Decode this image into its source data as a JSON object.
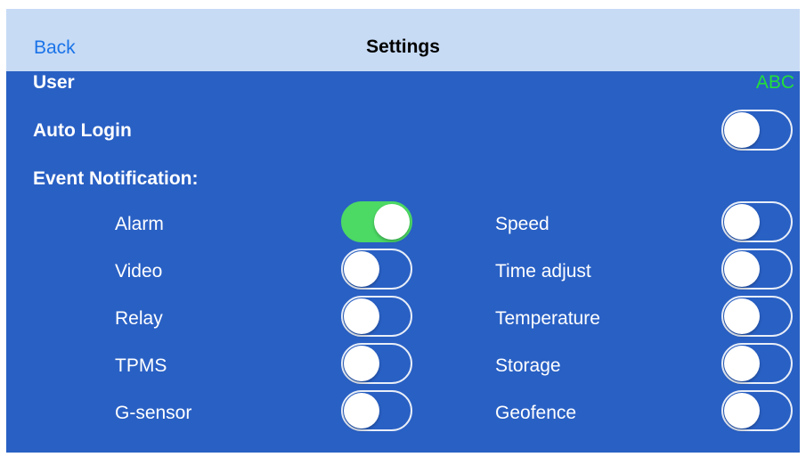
{
  "nav": {
    "back_label": "Back",
    "title": "Settings"
  },
  "user": {
    "label": "User",
    "value": "ABC",
    "value_color": "#22e03a"
  },
  "auto_login": {
    "label": "Auto Login",
    "on": false
  },
  "events": {
    "heading": "Event Notification:",
    "left": [
      {
        "label": "Alarm",
        "on": true
      },
      {
        "label": "Video",
        "on": false
      },
      {
        "label": "Relay",
        "on": false
      },
      {
        "label": "TPMS",
        "on": false
      },
      {
        "label": "G-sensor",
        "on": false
      }
    ],
    "right": [
      {
        "label": "Speed",
        "on": false
      },
      {
        "label": "Time adjust",
        "on": false
      },
      {
        "label": "Temperature",
        "on": false
      },
      {
        "label": "Storage",
        "on": false
      },
      {
        "label": "Geofence",
        "on": false
      }
    ]
  },
  "colors": {
    "nav_bg": "#c7dbf5",
    "content_bg": "#2960c4",
    "toggle_on": "#4cd964",
    "link": "#1a73e8"
  }
}
